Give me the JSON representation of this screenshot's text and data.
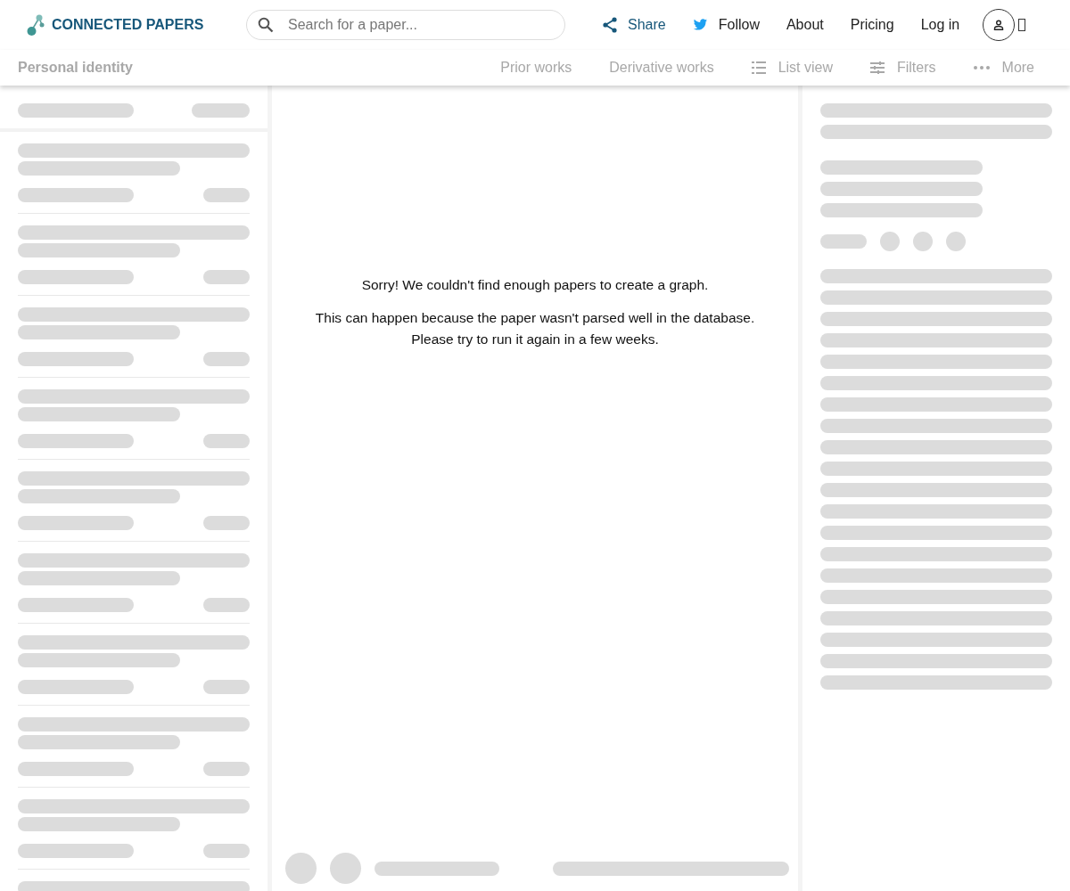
{
  "header": {
    "logo_text": "CONNECTED PAPERS",
    "search": {
      "placeholder": "Search for a paper..."
    },
    "nav": [
      {
        "kind": "share",
        "label": "Share"
      },
      {
        "kind": "follow",
        "label": "Follow"
      },
      {
        "kind": "plain",
        "label": "About"
      },
      {
        "kind": "plain",
        "label": "Pricing"
      },
      {
        "kind": "plain",
        "label": "Log in"
      }
    ]
  },
  "toolbar": {
    "title": "Personal identity",
    "items": [
      {
        "kind": "text",
        "label": "Prior works",
        "disabled": true
      },
      {
        "kind": "text",
        "label": "Derivative works",
        "disabled": true
      },
      {
        "kind": "list",
        "label": "List view",
        "disabled": true
      },
      {
        "kind": "filters",
        "label": "Filters",
        "disabled": true
      },
      {
        "kind": "more",
        "label": "More",
        "disabled": true
      }
    ]
  },
  "graph_message": {
    "title": "Sorry! We couldn't find enough papers to create a graph.",
    "lines": [
      "This can happen because the paper wasn't parsed well in the database.",
      "Please try to run it again in a few weeks."
    ]
  }
}
